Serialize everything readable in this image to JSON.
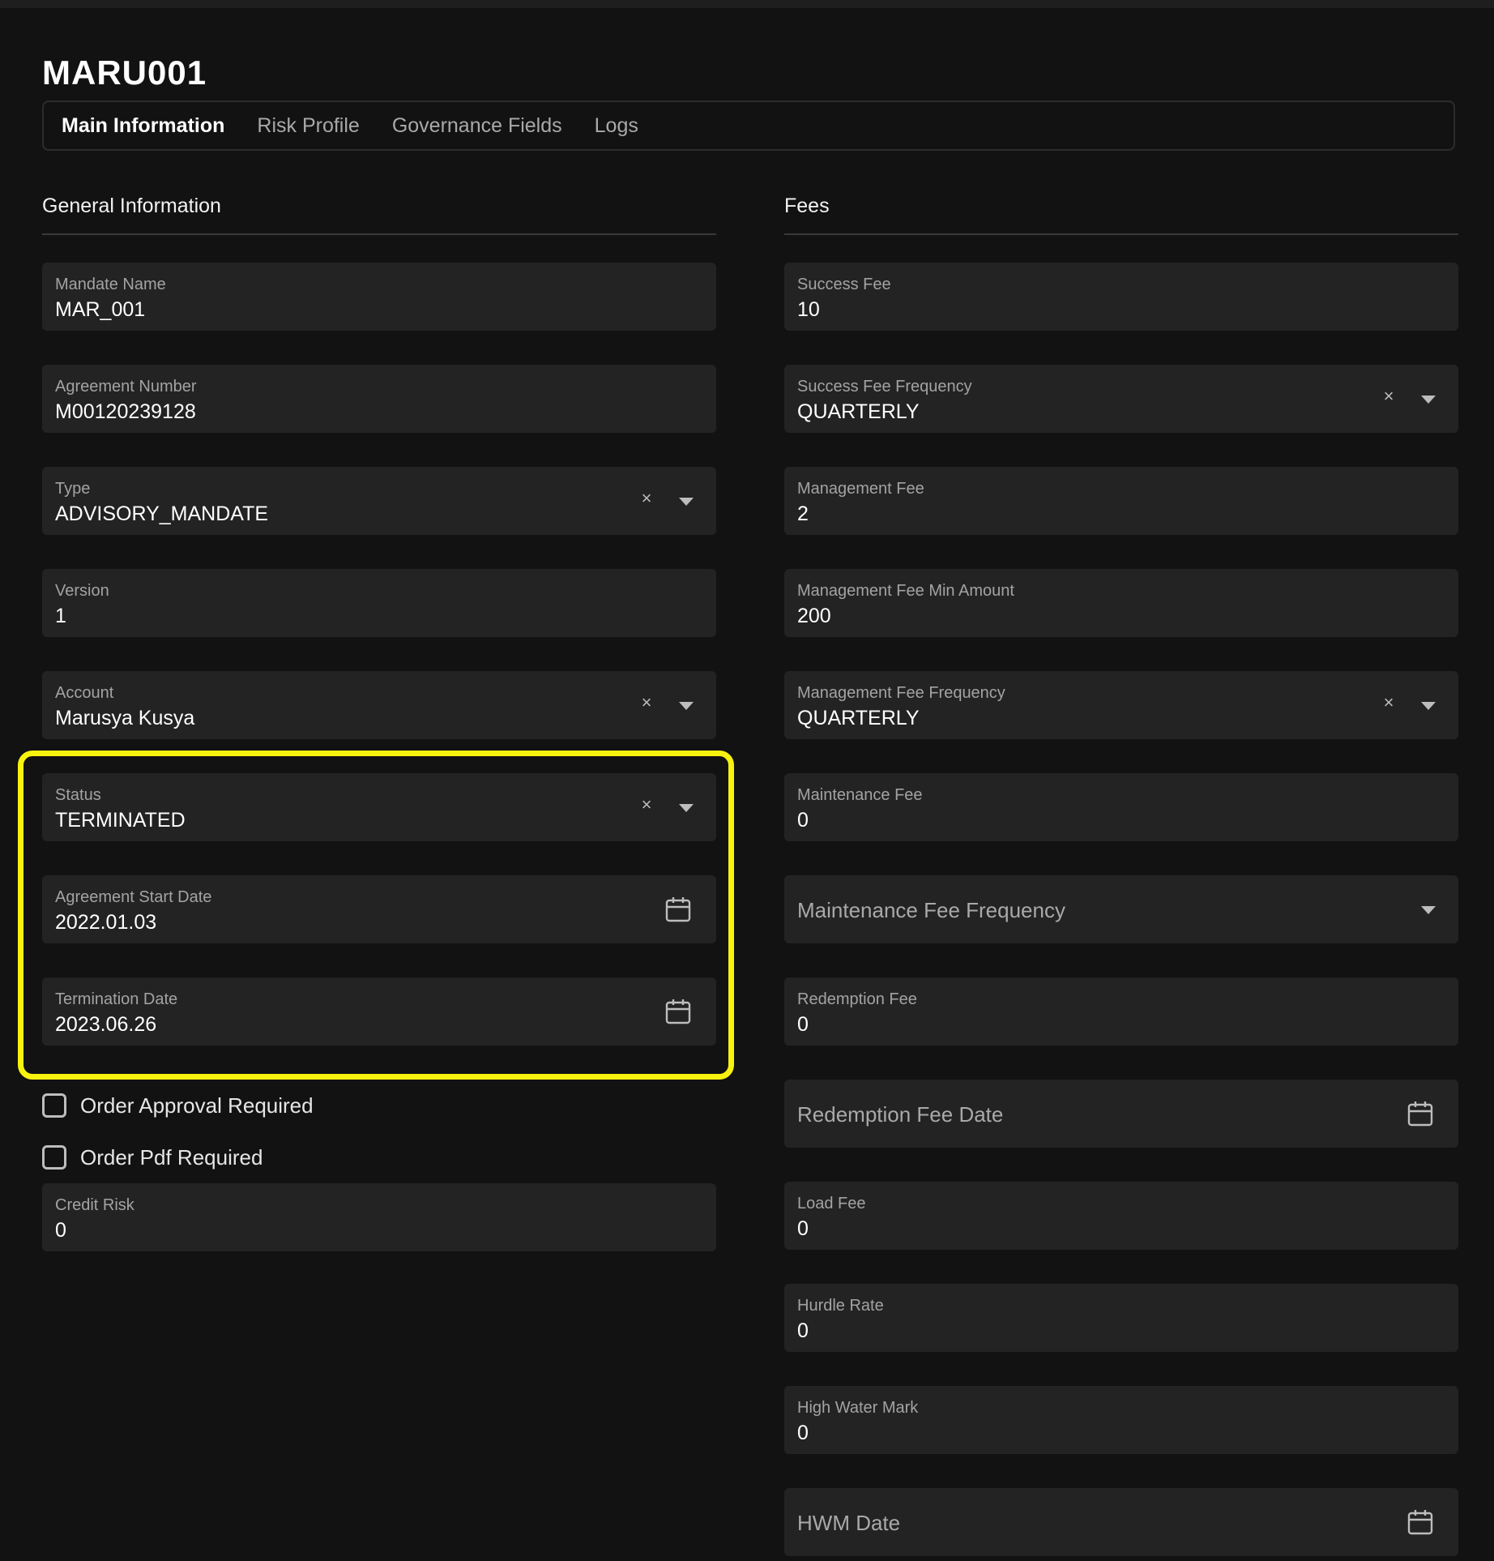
{
  "page": {
    "title": "MARU001"
  },
  "tabs": [
    {
      "label": "Main Information",
      "active": true
    },
    {
      "label": "Risk Profile",
      "active": false
    },
    {
      "label": "Governance Fields",
      "active": false
    },
    {
      "label": "Logs",
      "active": false
    }
  ],
  "general": {
    "title": "General Information",
    "mandate_name": {
      "label": "Mandate Name",
      "value": "MAR_001"
    },
    "agreement_number": {
      "label": "Agreement Number",
      "value": "M00120239128"
    },
    "type": {
      "label": "Type",
      "value": "ADVISORY_MANDATE"
    },
    "version": {
      "label": "Version",
      "value": "1"
    },
    "account": {
      "label": "Account",
      "value": "Marusya Kusya"
    },
    "status": {
      "label": "Status",
      "value": "TERMINATED"
    },
    "agreement_start_date": {
      "label": "Agreement Start Date",
      "value": "2022.01.03"
    },
    "termination_date": {
      "label": "Termination Date",
      "value": "2023.06.26"
    },
    "order_approval_required": {
      "label": "Order Approval Required",
      "checked": false
    },
    "order_pdf_required": {
      "label": "Order Pdf Required",
      "checked": false
    },
    "credit_risk": {
      "label": "Credit Risk",
      "value": "0"
    }
  },
  "fees": {
    "title": "Fees",
    "success_fee": {
      "label": "Success Fee",
      "value": "10"
    },
    "success_fee_frequency": {
      "label": "Success Fee Frequency",
      "value": "QUARTERLY"
    },
    "management_fee": {
      "label": "Management Fee",
      "value": "2"
    },
    "management_fee_min_amount": {
      "label": "Management Fee Min Amount",
      "value": "200"
    },
    "management_fee_frequency": {
      "label": "Management Fee Frequency",
      "value": "QUARTERLY"
    },
    "maintenance_fee": {
      "label": "Maintenance Fee",
      "value": "0"
    },
    "maintenance_fee_frequency": {
      "placeholder": "Maintenance Fee Frequency"
    },
    "redemption_fee": {
      "label": "Redemption Fee",
      "value": "0"
    },
    "redemption_fee_date": {
      "placeholder": "Redemption Fee Date"
    },
    "load_fee": {
      "label": "Load Fee",
      "value": "0"
    },
    "hurdle_rate": {
      "label": "Hurdle Rate",
      "value": "0"
    },
    "high_water_mark": {
      "label": "High Water Mark",
      "value": "0"
    },
    "hwm_date": {
      "placeholder": "HWM Date"
    }
  },
  "icons": {
    "clear": "close-icon",
    "dropdown": "chevron-down-icon",
    "date": "calendar-icon"
  },
  "colors": {
    "background": "#121212",
    "field_background": "#232323",
    "highlight": "#f8f20f"
  }
}
